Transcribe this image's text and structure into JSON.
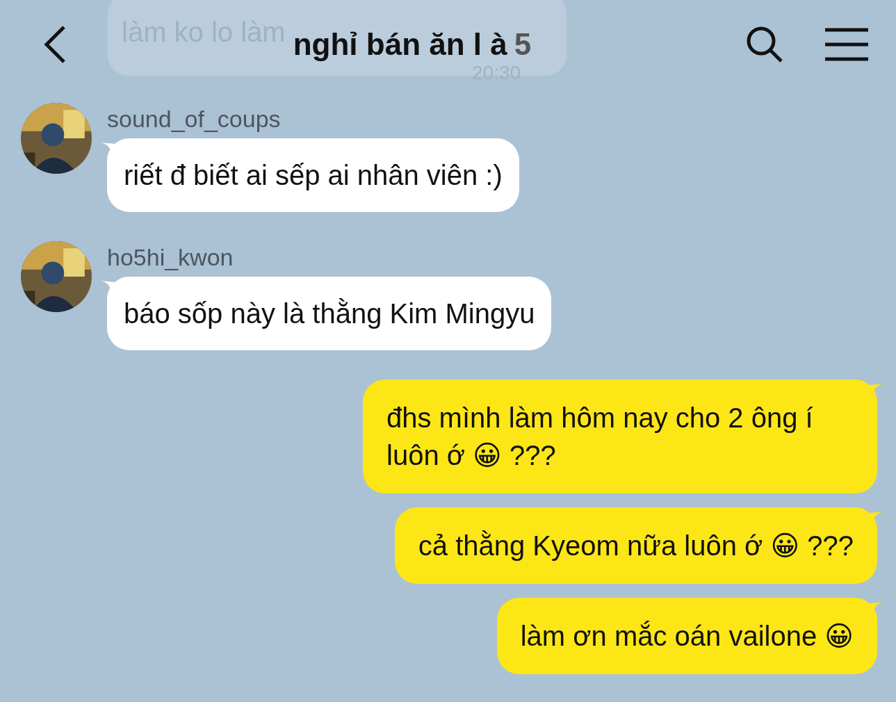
{
  "header": {
    "title": "nghỉ bán ăn l à",
    "member_count": "5"
  },
  "faded_message": {
    "text": "làm ko lo làm",
    "time": "20:30"
  },
  "messages": [
    {
      "kind": "incoming",
      "sender": "sound_of_coups",
      "text": "riết đ biết ai sếp ai nhân viên :)"
    },
    {
      "kind": "incoming",
      "sender": "ho5hi_kwon",
      "text": "báo sốp này là thằng Kim Mingyu"
    },
    {
      "kind": "outgoing",
      "text": "đhs mình làm hôm nay cho 2 ông í luôn ớ 😀 ???"
    },
    {
      "kind": "outgoing",
      "text": "cả thằng Kyeom nữa luôn ớ 😀 ???"
    },
    {
      "kind": "outgoing",
      "text": "làm ơn mắc oán vailone 😀"
    }
  ]
}
